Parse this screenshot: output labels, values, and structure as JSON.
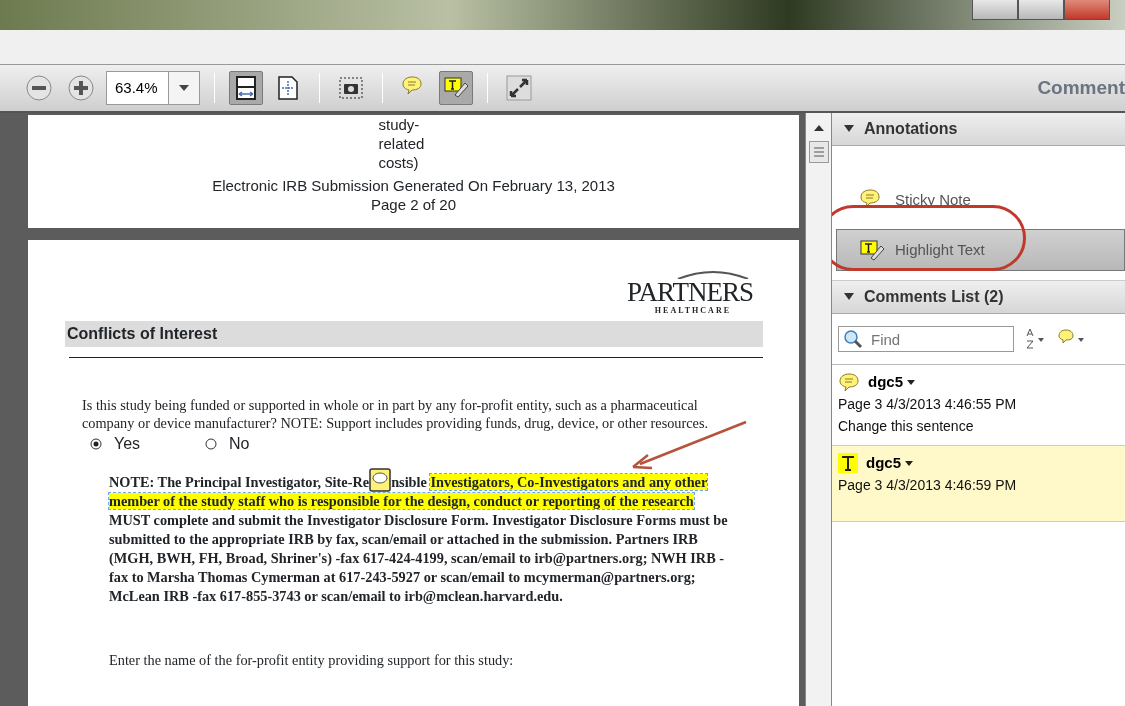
{
  "toolbar": {
    "zoom": "63.4%",
    "tools": [
      {
        "kind": "fit_width",
        "selected": true
      },
      {
        "kind": "fit_page",
        "selected": false
      },
      {
        "kind": "snapshot",
        "selected": false
      },
      {
        "kind": "sticky_note",
        "selected": false
      },
      {
        "kind": "highlight",
        "selected": true
      },
      {
        "kind": "full_screen",
        "selected": false
      }
    ],
    "pane_title": "Comment"
  },
  "document": {
    "top_page": {
      "lines": [
        "study-",
        "related",
        "costs)"
      ],
      "footer": [
        "Electronic IRB Submission Generated On February 13, 2013",
        "Page 2 of 20"
      ]
    },
    "page": {
      "logo": "PARTNERS",
      "logo_sub": "HEALTHCARE",
      "section_title": "Conflicts of Interest",
      "question": "Is this study being funded or supported in whole or in part by any for-profit entity, such as a pharmaceutical company or device manufacturer?  NOTE: Support includes providing funds, drug, device, or other resources.",
      "options": [
        {
          "label": "Yes",
          "selected": true
        },
        {
          "label": "No",
          "selected": false
        }
      ],
      "note_lines": [
        [
          {
            "kind": "text",
            "text": "NOTE: The Principal Investigator, Site-Re"
          },
          {
            "kind": "sticky_note"
          },
          {
            "kind": "text",
            "text": "nsible"
          },
          {
            "kind": "highlight",
            "text": "Investigators, Co-Investigators and any other"
          }
        ],
        [
          {
            "kind": "highlight",
            "text": "member of the study staff who is responsible for the design, conduct or reporting of the research"
          }
        ],
        [
          {
            "kind": "text",
            "text": "MUST complete and submit the Investigator Disclosure Form. Investigator Disclosure Forms must be submitted to the appropriate IRB by fax, scan/email or attached in the submission.  Partners IRB (MGH, BWH, FH, Broad, Shriner's) -fax 617-424-4199, scan/email to irb@partners.org; NWH IRB -fax to Marsha Thomas Cymerman at 617-243-5927 or scan/email to mcymerman@partners.org; McLean IRB -fax 617-855-3743 or scan/email to irb@mclean.harvard.edu."
          }
        ]
      ],
      "prompt": "Enter the name of the for-profit entity providing support for this study:"
    }
  },
  "annotations": {
    "title": "Annotations",
    "expanded": true,
    "tools": [
      {
        "kind": "sticky_note",
        "label": "Sticky Note",
        "selected": false
      },
      {
        "kind": "highlight",
        "label": "Highlight Text",
        "selected": true
      }
    ]
  },
  "comments_list": {
    "title": "Comments List (2)",
    "expanded": true,
    "find_placeholder": "Find",
    "items": [
      {
        "kind": "sticky_note",
        "author": "dgc5",
        "meta": "Page 3  4/3/2013 4:46:55 PM",
        "text": "Change this sentence",
        "selected": false
      },
      {
        "kind": "highlight",
        "author": "dgc5",
        "meta": "Page 3  4/3/2013 4:46:59 PM",
        "selected": true
      }
    ]
  }
}
